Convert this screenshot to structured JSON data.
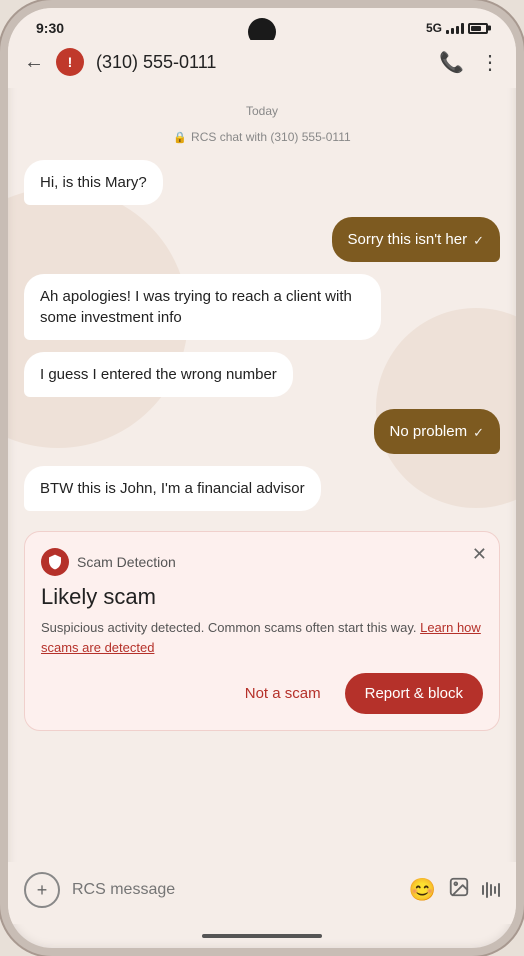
{
  "statusBar": {
    "time": "9:30",
    "signal": "5G"
  },
  "header": {
    "backLabel": "←",
    "contactNumber": "(310) 555-0111",
    "phoneIconLabel": "📞",
    "moreIconLabel": "⋮"
  },
  "chat": {
    "dateSeparator": "Today",
    "rcsLabel": "RCS chat with (310) 555-0111",
    "messages": [
      {
        "id": 1,
        "type": "incoming",
        "text": "Hi, is this Mary?"
      },
      {
        "id": 2,
        "type": "outgoing",
        "text": "Sorry this isn't her",
        "checkmark": "✓"
      },
      {
        "id": 3,
        "type": "incoming",
        "text": "Ah apologies! I was trying to reach a client with some investment info"
      },
      {
        "id": 4,
        "type": "incoming",
        "text": "I guess I entered the wrong number"
      },
      {
        "id": 5,
        "type": "outgoing",
        "text": "No problem",
        "checkmark": "✓"
      },
      {
        "id": 6,
        "type": "incoming",
        "text": "BTW this is John, I'm a financial advisor"
      }
    ]
  },
  "scamCard": {
    "iconLabel": "🛡",
    "detectionLabel": "Scam Detection",
    "title": "Likely scam",
    "description": "Suspicious activity detected. Common scams often start this way.",
    "learnMoreText": "Learn how scams are detected",
    "notScamLabel": "Not a scam",
    "reportBlockLabel": "Report & block",
    "closeLabel": "✕"
  },
  "inputBar": {
    "addIconLabel": "+",
    "placeholder": "RCS message",
    "emojiIconLabel": "😊",
    "imageIconLabel": "⊞"
  }
}
